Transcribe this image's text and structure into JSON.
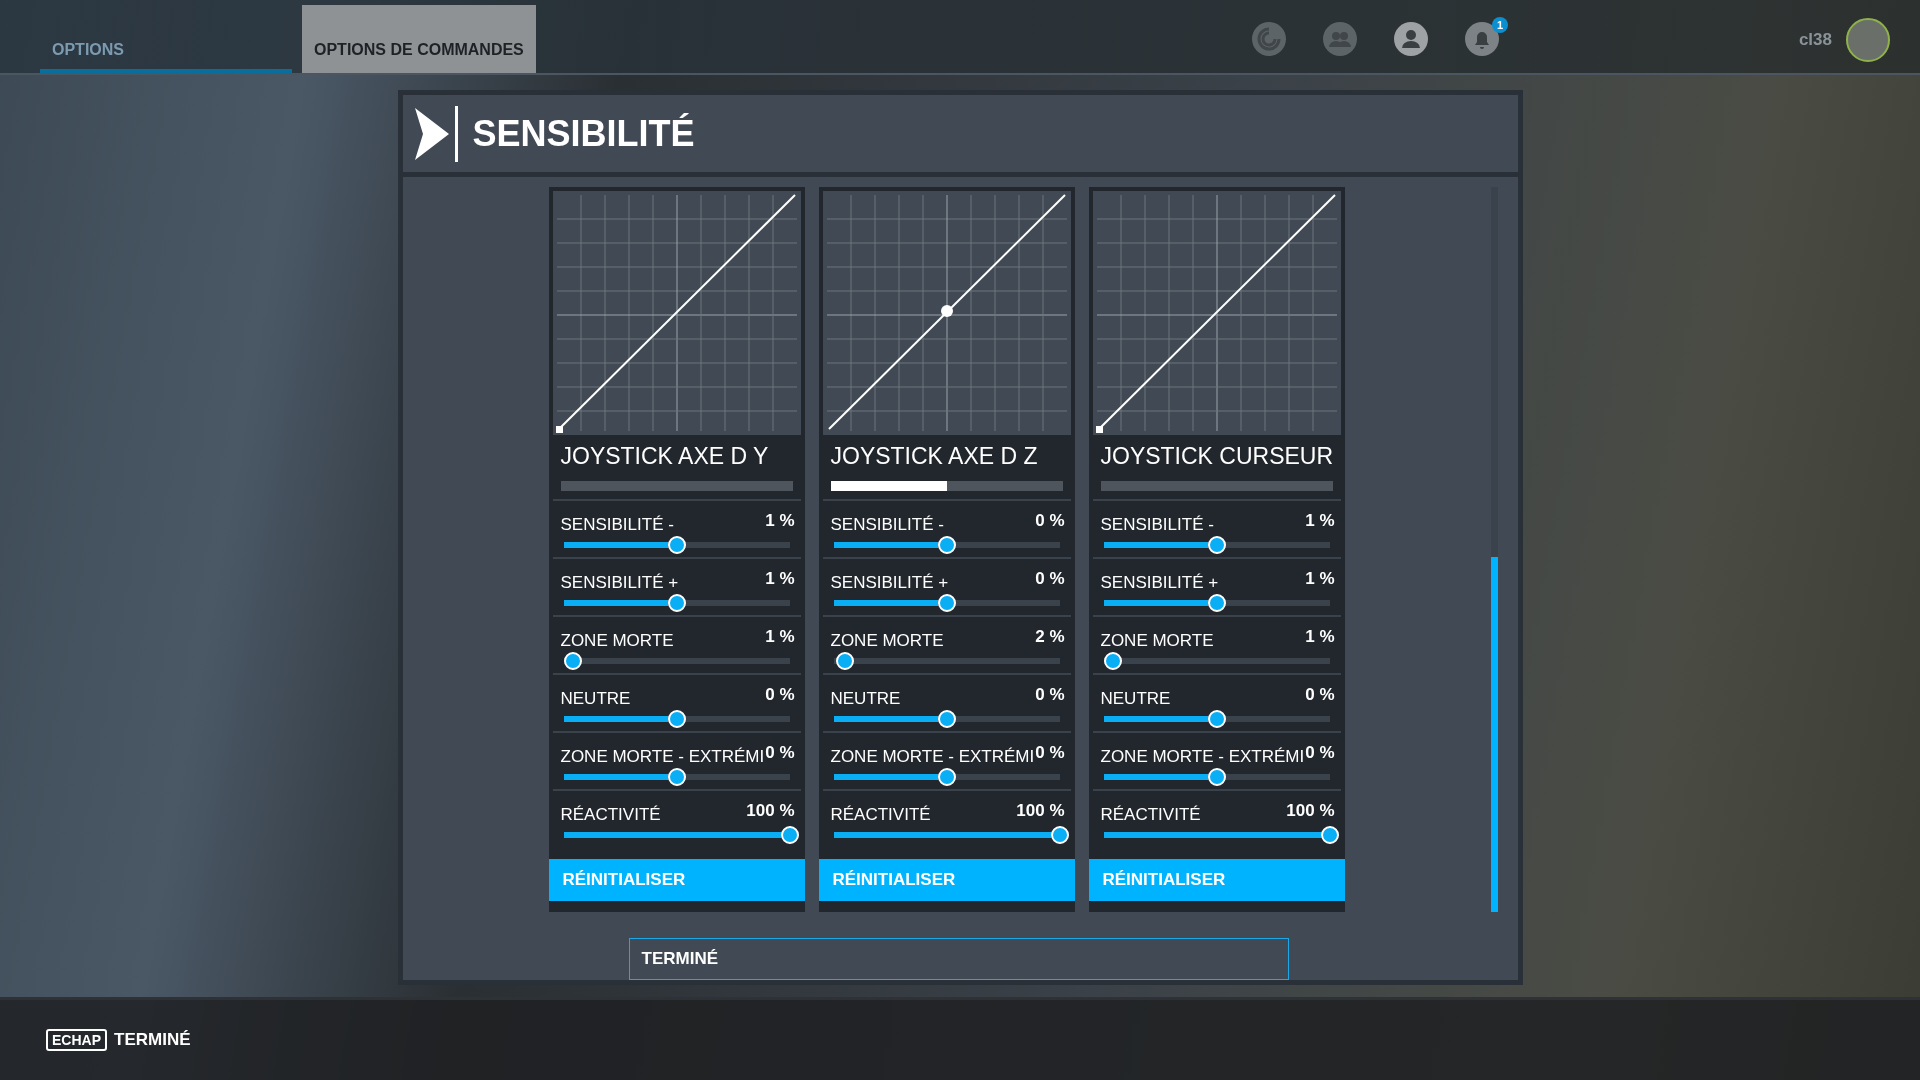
{
  "top_bar": {
    "tabs": [
      {
        "label": "OPTIONS",
        "selected": true
      },
      {
        "label": "OPTIONS DE COMMANDES",
        "selected": false
      }
    ],
    "notification_count": "1",
    "username": "cl38"
  },
  "dialog": {
    "title": "SENSIBILITÉ",
    "panels": [
      {
        "title": "JOYSTICK AXE D Y",
        "input": {
          "level": 0
        },
        "settings": [
          {
            "label": "SENSIBILITÉ -",
            "value": "1 %",
            "level": 0.5
          },
          {
            "label": "SENSIBILITÉ +",
            "value": "1 %",
            "level": 0.5
          },
          {
            "label": "ZONE MORTE",
            "value": "1 %",
            "level": 0.04
          },
          {
            "label": "NEUTRE",
            "value": "0 %",
            "level": 0.5
          },
          {
            "label": "ZONE MORTE - EXTRÉMI",
            "value": "0 %",
            "level": 0.5
          },
          {
            "label": "RÉACTIVITÉ",
            "value": "100 %",
            "level": 1
          }
        ],
        "reset_label": "RÉINITIALISER"
      },
      {
        "title": "JOYSTICK AXE D Z",
        "input": {
          "level": 0.5
        },
        "settings": [
          {
            "label": "SENSIBILITÉ -",
            "value": "0 %",
            "level": 0.5
          },
          {
            "label": "SENSIBILITÉ +",
            "value": "0 %",
            "level": 0.5
          },
          {
            "label": "ZONE MORTE",
            "value": "2 %",
            "level": 0.05
          },
          {
            "label": "NEUTRE",
            "value": "0 %",
            "level": 0.5
          },
          {
            "label": "ZONE MORTE - EXTRÉMI",
            "value": "0 %",
            "level": 0.5
          },
          {
            "label": "RÉACTIVITÉ",
            "value": "100 %",
            "level": 1
          }
        ],
        "reset_label": "RÉINITIALISER"
      },
      {
        "title": "JOYSTICK CURSEUR",
        "input": {
          "level": 0
        },
        "settings": [
          {
            "label": "SENSIBILITÉ -",
            "value": "1 %",
            "level": 0.5
          },
          {
            "label": "SENSIBILITÉ +",
            "value": "1 %",
            "level": 0.5
          },
          {
            "label": "ZONE MORTE",
            "value": "1 %",
            "level": 0.04
          },
          {
            "label": "NEUTRE",
            "value": "0 %",
            "level": 0.5
          },
          {
            "label": "ZONE MORTE - EXTRÉMI",
            "value": "0 %",
            "level": 0.5
          },
          {
            "label": "RÉACTIVITÉ",
            "value": "100 %",
            "level": 1
          }
        ],
        "reset_label": "RÉINITIALISER"
      }
    ],
    "done_button": "TERMINÉ"
  },
  "bottom_bar": {
    "key": "ECHAP",
    "action": "TERMINÉ"
  }
}
